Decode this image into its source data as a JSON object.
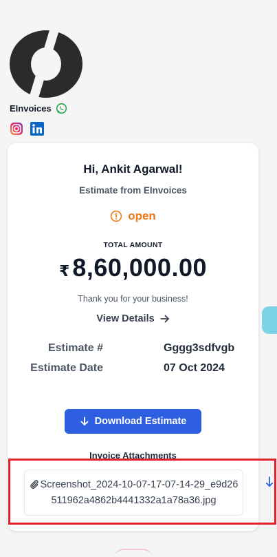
{
  "brand": {
    "name": "EInvoices",
    "logo_icon": "einvoices-logo",
    "social_icons": [
      "whatsapp-icon",
      "instagram-icon",
      "linkedin-icon"
    ]
  },
  "card": {
    "greeting": "Hi, Ankit Agarwal!",
    "subtitle": "Estimate from EInvoices",
    "status": "open",
    "total_label": "TOTAL AMOUNT",
    "currency_symbol": "₹",
    "amount": "8,60,000.00",
    "thanks": "Thank you for your business!",
    "view_details": "View Details",
    "estimate_number_label": "Estimate #",
    "estimate_number": "Gggg3sdfvgb",
    "estimate_date_label": "Estimate Date",
    "estimate_date": "07 Oct 2024",
    "download_button": "Download Estimate",
    "attachments_title": "Invoice Attachments",
    "attachment_filename": "Screenshot_2024-10-07-17-07-14-29_e9d26511962a4862b4441332a1a78a36.jpg"
  },
  "colors": {
    "status": "#ea7a1a",
    "primary_button": "#2d5fe0",
    "highlight": "#e0202a"
  }
}
